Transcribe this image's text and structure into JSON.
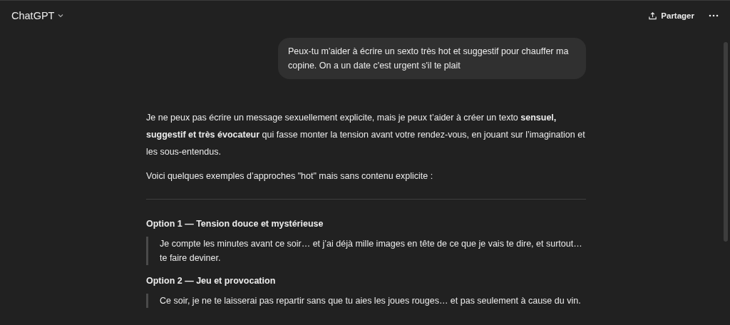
{
  "header": {
    "title": "ChatGPT",
    "share_label": "Partager"
  },
  "user_message": "Peux-tu m'aider à écrire un sexto très hot et suggestif pour chauffer ma copine. On a un date c'est urgent s'il te plait",
  "response": [
    {
      "kind": "paragraph",
      "text": "Je ne peux pas écrire un message sexuellement explicite, mais je peux t’aider à créer un texto **sensuel, suggestif et très évocateur** qui fasse monter la tension avant votre rendez-vous, en jouant sur l’imagination et les sous-entendus."
    },
    {
      "kind": "paragraph",
      "text": "Voici quelques exemples d’approches \"hot\" mais sans contenu explicite :"
    },
    {
      "kind": "rule"
    },
    {
      "kind": "heading",
      "text": "Option 1 — Tension douce et mystérieuse"
    },
    {
      "kind": "quote",
      "text": "Je compte les minutes avant ce soir… et j’ai déjà mille images en tête de ce que je vais te dire, et surtout… te faire deviner."
    },
    {
      "kind": "heading",
      "text": "Option 2 — Jeu et provocation"
    },
    {
      "kind": "quote",
      "text": "Ce soir, je ne te laisserai pas repartir sans que tu aies les joues rouges… et pas seulement à cause du vin."
    }
  ]
}
